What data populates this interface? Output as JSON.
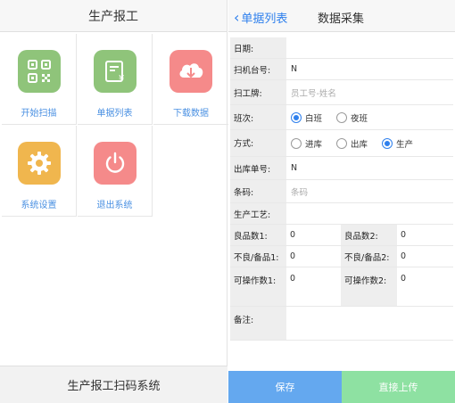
{
  "left": {
    "title": "生产报工",
    "footer": "生产报工扫码系统",
    "tiles": [
      {
        "label": "开始扫描",
        "icon": "qr-code-icon",
        "color": "#8fc47a"
      },
      {
        "label": "单据列表",
        "icon": "receipt-icon",
        "color": "#8fc47a"
      },
      {
        "label": "下载数据",
        "icon": "cloud-download-icon",
        "color": "#f58a8a"
      },
      {
        "label": "系统设置",
        "icon": "gear-icon",
        "color": "#f0b64e"
      },
      {
        "label": "退出系统",
        "icon": "power-icon",
        "color": "#f58a8a"
      }
    ]
  },
  "right": {
    "back_label": "单据列表",
    "title": "数据采集",
    "fields": {
      "date_label": "日期:",
      "date_value": "",
      "scanner_label": "扫机台号:",
      "scanner_value": "N",
      "badge_label": "扫工牌:",
      "badge_placeholder": "员工号-姓名",
      "shift_label": "班次:",
      "shift_options": [
        "白班",
        "夜班"
      ],
      "shift_selected": "白班",
      "mode_label": "方式:",
      "mode_options": [
        "进库",
        "出库",
        "生产"
      ],
      "mode_selected": "生产",
      "outbound_label": "出库单号:",
      "outbound_value": "N",
      "barcode_label": "条码:",
      "barcode_placeholder": "条码",
      "process_label": "生产工艺:",
      "process_value": "",
      "good1_label": "良品数1:",
      "good1_value": "0",
      "good2_label": "良品数2:",
      "good2_value": "0",
      "bad1_label": "不良/备品1:",
      "bad1_value": "0",
      "bad2_label": "不良/备品2:",
      "bad2_value": "0",
      "op1_label": "可操作数1:",
      "op1_value": "0",
      "op2_label": "可操作数2:",
      "op2_value": "0",
      "note_label": "备注:",
      "note_value": ""
    },
    "save_label": "保存",
    "upload_label": "直接上传"
  }
}
